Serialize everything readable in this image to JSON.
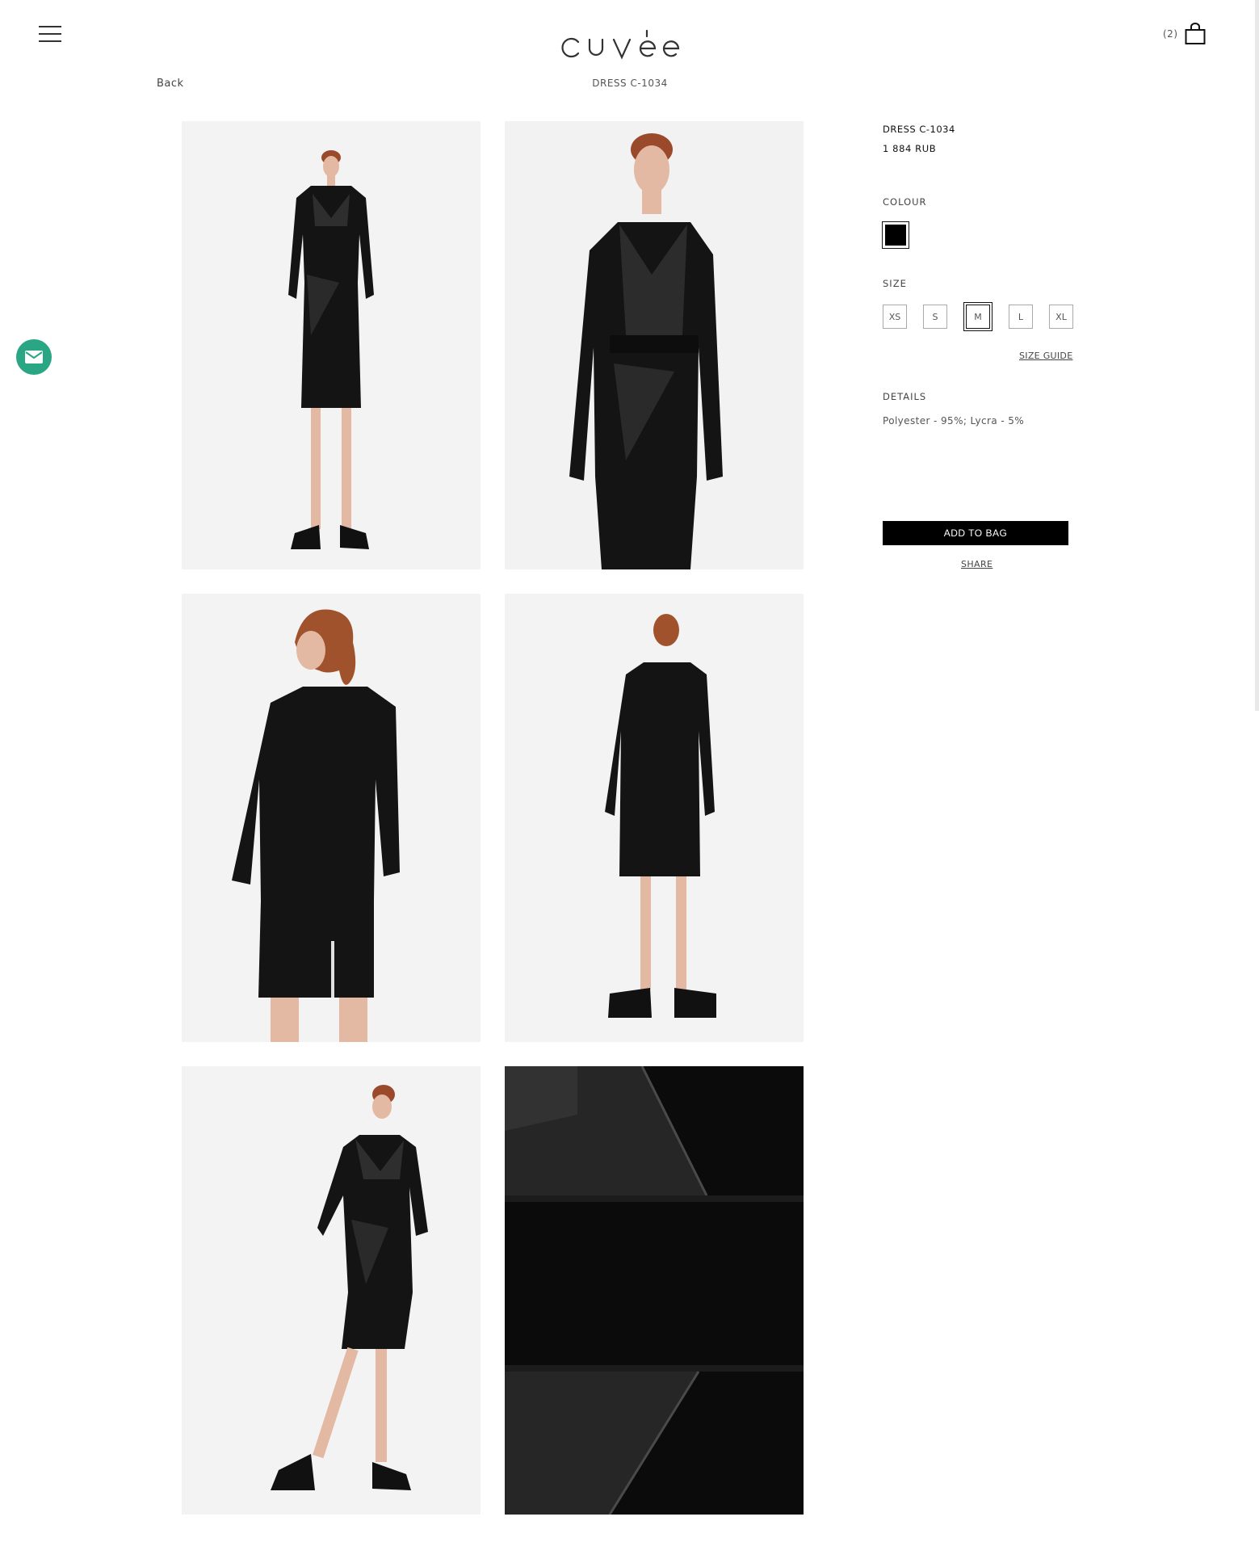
{
  "header": {
    "menu_icon": "hamburger-menu-icon",
    "logo_text": "cuvée",
    "cart_count": "(2)",
    "cart_icon": "shopping-bag-icon"
  },
  "nav": {
    "back_label": "Back",
    "page_title": "DRESS C-1034"
  },
  "gallery": {
    "photos": [
      {
        "label": "front view full length"
      },
      {
        "label": "front view close"
      },
      {
        "label": "back view close"
      },
      {
        "label": "back view full length"
      },
      {
        "label": "side view full length"
      },
      {
        "label": "fabric detail"
      }
    ]
  },
  "product": {
    "title": "DRESS C-1034",
    "price": "1 884 RUB",
    "colour_label": "COLOUR",
    "colour_hex": "#000000",
    "size_label": "SIZE",
    "sizes": [
      "XS",
      "S",
      "M",
      "L",
      "XL"
    ],
    "selected_size": "M",
    "size_guide_label": "SIZE GUIDE",
    "details_label": "DETAILS",
    "details_text": "Polyester - 95%; Lycra - 5%",
    "add_to_bag_label": "ADD TO BAG",
    "share_label": "SHARE"
  },
  "contact": {
    "icon": "envelope-icon",
    "accent": "#2aa685"
  }
}
